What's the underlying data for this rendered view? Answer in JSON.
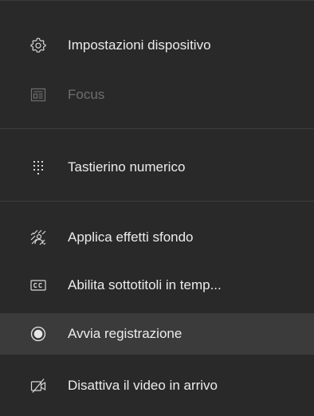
{
  "menu": {
    "items": [
      {
        "label": "Impostazioni dispositivo",
        "icon": "gear-icon",
        "state": "enabled"
      },
      {
        "label": "Focus",
        "icon": "focus-icon",
        "state": "disabled"
      },
      {
        "label": "Tastierino numerico",
        "icon": "dialpad-icon",
        "state": "enabled"
      },
      {
        "label": "Applica effetti sfondo",
        "icon": "background-effects-icon",
        "state": "enabled"
      },
      {
        "label": "Abilita sottotitoli in temp...",
        "icon": "closed-captions-icon",
        "state": "enabled"
      },
      {
        "label": "Avvia registrazione",
        "icon": "record-icon",
        "state": "hovered"
      },
      {
        "label": "Disattiva il video in arrivo",
        "icon": "video-off-icon",
        "state": "enabled"
      }
    ]
  },
  "colors": {
    "background": "#292929",
    "text": "#ececec",
    "disabled_text": "#6e6e6e",
    "hover_background": "#3b3b3b"
  }
}
